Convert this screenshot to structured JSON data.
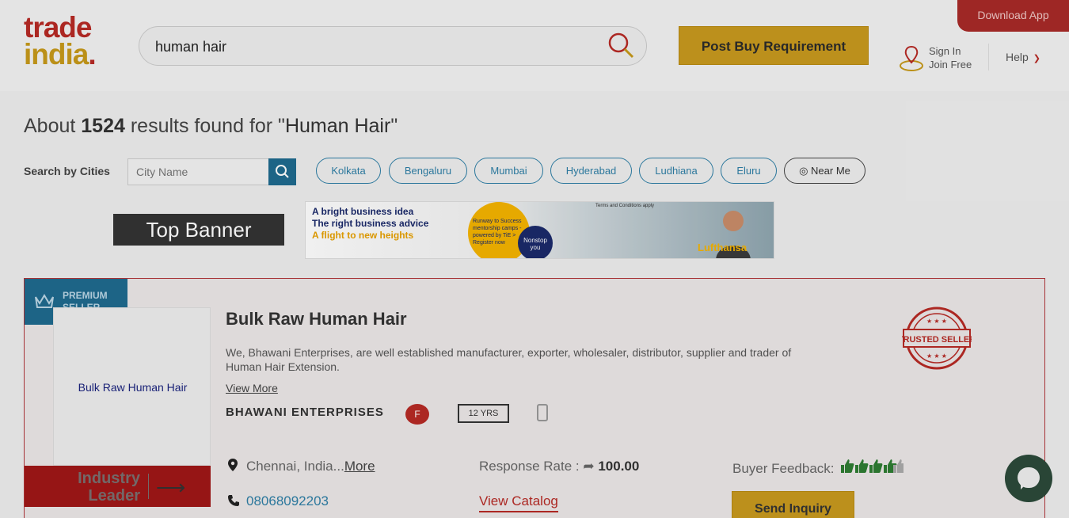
{
  "header": {
    "logo_line1": "trade",
    "logo_line2": "india",
    "logo_dot": ".",
    "search_value": "human hair",
    "post_button": "Post Buy Requirement",
    "download_app": "Download App",
    "sign_in": "Sign In",
    "join_free": "Join Free",
    "help": "Help"
  },
  "results": {
    "prefix": "About ",
    "count": "1524",
    "middle": " results found for \"",
    "query": "Human Hair",
    "suffix": "\""
  },
  "city_filter": {
    "label": "Search by Cities",
    "placeholder": "City Name",
    "chips": [
      "Kolkata",
      "Bengaluru",
      "Mumbai",
      "Hyderabad",
      "Ludhiana",
      "Eluru"
    ],
    "near_me": "Near Me"
  },
  "banner": {
    "label": "Top Banner",
    "line1": "A bright business idea",
    "line2": "The right business advice",
    "line3": "A flight to new heights",
    "circle_text": "Runway to Success mentorship camps - powered by TiE > Register now",
    "badge_text": "Nonstop you",
    "terms": "Terms and Conditions apply",
    "brand": "Lufthansa"
  },
  "listing": {
    "premium_line1": "PREMIUM",
    "premium_line2": "SELLER",
    "thumb_title": "Bulk Raw Human Hair",
    "industry_line1": "Industry",
    "industry_line2": "Leader",
    "title": "Bulk Raw Human Hair",
    "description": "We, Bhawani Enterprises, are well established manufacturer, exporter, wholesaler, distributor, supplier and trader of Human Hair Extension.",
    "view_more": "View More",
    "company": "BHAWANI ENTERPRISES",
    "f_badge": "F",
    "years": "12 YRS",
    "location": "Chennai, India...",
    "location_more": "More",
    "phone": "08068092203",
    "response_label": "Response Rate : ",
    "response_value": "100.00",
    "view_catalog": "View Catalog",
    "feedback_label": "Buyer Feedback:",
    "feedback_rating": 4,
    "feedback_max": 5,
    "send_inquiry": "Send Inquiry",
    "trusted_text": "TRUSTED SELLER"
  },
  "colors": {
    "brand_red": "#b72a25",
    "brand_gold": "#c89a1e",
    "accent_blue": "#2e7fa6"
  }
}
